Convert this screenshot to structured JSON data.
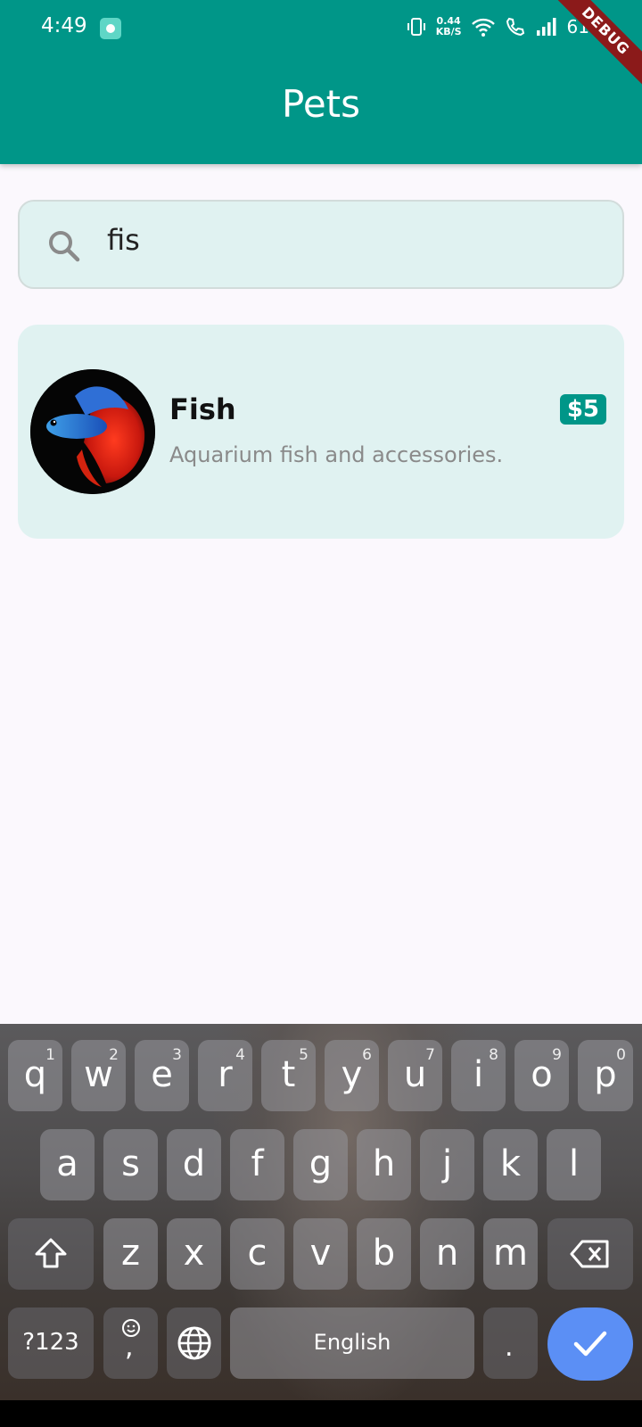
{
  "status_bar": {
    "time": "4:49",
    "speed_value": "0.44",
    "speed_unit": "KB/S",
    "battery": "61%"
  },
  "debug_banner": "DEBUG",
  "app_bar": {
    "title": "Pets"
  },
  "search": {
    "value": "fis"
  },
  "results": [
    {
      "name": "Fish",
      "description": "Aquarium fish and accessories.",
      "price": "$5"
    }
  ],
  "keyboard": {
    "row1": [
      {
        "key": "q",
        "hint": "1"
      },
      {
        "key": "w",
        "hint": "2"
      },
      {
        "key": "e",
        "hint": "3"
      },
      {
        "key": "r",
        "hint": "4"
      },
      {
        "key": "t",
        "hint": "5"
      },
      {
        "key": "y",
        "hint": "6"
      },
      {
        "key": "u",
        "hint": "7"
      },
      {
        "key": "i",
        "hint": "8"
      },
      {
        "key": "o",
        "hint": "9"
      },
      {
        "key": "p",
        "hint": "0"
      }
    ],
    "row2": [
      "a",
      "s",
      "d",
      "f",
      "g",
      "h",
      "j",
      "k",
      "l"
    ],
    "row3": [
      "z",
      "x",
      "c",
      "v",
      "b",
      "n",
      "m"
    ],
    "symbols_label": "?123",
    "comma": ",",
    "period": ".",
    "space_label": "English"
  },
  "colors": {
    "primary": "#009688",
    "card_bg": "#e0f2f1",
    "page_bg": "#fbf8fd",
    "enter_key": "#5b8ff5",
    "debug": "#8b1a1a"
  }
}
